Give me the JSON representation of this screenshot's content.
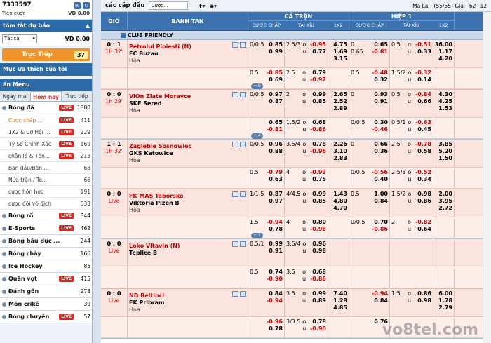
{
  "account": {
    "user": "7333597",
    "credit_label": "Tiền cược",
    "credit_value": "VD 0.00"
  },
  "summary": {
    "title": "tóm tắt dự báo",
    "select": "Tất cả",
    "balance": "VD 0.00"
  },
  "live_btn": {
    "label": "Trực Tiếp",
    "count": "37"
  },
  "favorites": {
    "label": "Mục ưa thích của tôi"
  },
  "menu": {
    "label": "ẩn Menu",
    "tabs": [
      "Ngày mai",
      "Hôm nay",
      "Trực tiếp"
    ]
  },
  "sports": [
    {
      "name": "Bóng đá",
      "live": true,
      "count": "1880"
    },
    {
      "name": "Bóng rổ",
      "live": true,
      "count": "344"
    },
    {
      "name": "E-Sports",
      "live": true,
      "count": "462"
    },
    {
      "name": "Bóng bầu dục ...",
      "live": false,
      "count": "244"
    },
    {
      "name": "Bóng chày",
      "live": false,
      "count": "166"
    },
    {
      "name": "Ice Hockey",
      "live": false,
      "count": "85"
    },
    {
      "name": "Quần vợt",
      "live": true,
      "count": "415"
    },
    {
      "name": "Đánh gôn",
      "live": false,
      "count": "278"
    },
    {
      "name": "Môn crikê",
      "live": false,
      "count": "39"
    },
    {
      "name": "Bóng chuyền",
      "live": true,
      "count": "57"
    }
  ],
  "football_subs": [
    {
      "name": "Cược chấp ...",
      "live": true,
      "count": "411"
    },
    {
      "name": "1X2 & Cơ Hội ...",
      "live": true,
      "count": "229"
    },
    {
      "name": "Tỷ Số Chính Xác",
      "live": true,
      "count": "169"
    },
    {
      "name": "chẵn lẻ & Tổn...",
      "live": true,
      "count": "213"
    },
    {
      "name": "Bàn đầu/Bàn ...",
      "live": false,
      "count": "68"
    },
    {
      "name": "Nửa trận / To...",
      "live": false,
      "count": "66"
    },
    {
      "name": "cược hỗn hợp",
      "live": false,
      "count": "191"
    },
    {
      "name": "cược đội vô địch",
      "live": false,
      "count": "533"
    }
  ],
  "topbar": {
    "title": "các cặp đấu",
    "search": "Cược...",
    "market": "Mã Lai",
    "count": "(55/55) Giải",
    "n1": "62",
    "n2": "12"
  },
  "header": {
    "time": "GIỜ",
    "team": "BANH TAN",
    "ft": "CẢ TRẬN",
    "ht": "HIỆP 1",
    "hc": "CƯỢC CHẤP",
    "ou": "TÀI XỈU",
    "x12": "1X2"
  },
  "league": "CLUB FRIENDLY",
  "matches": [
    {
      "score": "0 : 1",
      "time": "1H 32'",
      "home": "Petrolul Ploiesti (N)",
      "away": "FC Buzau",
      "draw": "Hòa",
      "rows": [
        {
          "hc": [
            "0/0.5",
            ""
          ],
          "hcv": [
            "0.85",
            "0.99"
          ],
          "ou": [
            "2.5/3",
            ""
          ],
          "ouu": [
            "o",
            "u"
          ],
          "ouv": [
            "-0.95",
            "0.77"
          ],
          "x12": [
            "4.75",
            "1.69",
            "3.15"
          ],
          "hc2": [
            "0",
            "0.65"
          ],
          "hc2v": [
            "0.65",
            "-0.81"
          ],
          "ou2": [
            "0.5",
            ""
          ],
          "ou2u": [
            "o",
            "u"
          ],
          "ou2v": [
            "-0.51",
            "0.33"
          ],
          "x122": [
            "36.00",
            "1.17",
            "4.20"
          ]
        },
        {
          "hc": [
            "0.5",
            ""
          ],
          "hcv": [
            "-0.85",
            "0.69"
          ],
          "ou": [
            "2.5",
            ""
          ],
          "ouu": [
            "o",
            "u"
          ],
          "ouv": [
            "0.79",
            "-0.97"
          ],
          "x12": [
            "",
            "",
            ""
          ],
          "hc2": [
            "0.5",
            ""
          ],
          "hc2v": [
            "-0.48",
            "0.32"
          ],
          "ou2": [
            "1.5/2",
            ""
          ],
          "ou2u": [
            "o",
            "u"
          ],
          "ou2v": [
            "-0.32",
            "0.14"
          ],
          "x122": [
            "",
            "",
            ""
          ],
          "plus": "+ 5"
        }
      ]
    },
    {
      "score": "0 : 0",
      "time": "1H 29'",
      "home": "ViOn Zlate Moravce",
      "away": "SKF Sered",
      "draw": "Hòa",
      "rows": [
        {
          "hc": [
            "0/0.5",
            ""
          ],
          "hcv": [
            "0.97",
            "0.87"
          ],
          "ou": [
            "2",
            ""
          ],
          "ouu": [
            "o",
            "u"
          ],
          "ouv": [
            "0.99",
            "0.85"
          ],
          "x12": [
            "2.65",
            "2.52",
            "2.89"
          ],
          "hc2": [
            "0",
            ""
          ],
          "hc2v": [
            "0.93",
            "0.91"
          ],
          "ou2": [
            "0.5",
            ""
          ],
          "ou2u": [
            "o",
            "u"
          ],
          "ou2v": [
            "-0.84",
            "0.66"
          ],
          "x122": [
            "4.30",
            "4.25",
            "1.53"
          ]
        },
        {
          "hc": [
            "",
            ""
          ],
          "hcv": [
            "0.65",
            "-0.81"
          ],
          "ou": [
            "1.5/2",
            ""
          ],
          "ouu": [
            "o",
            "u"
          ],
          "ouv": [
            "0.68",
            "-0.86"
          ],
          "x12": [
            "",
            "",
            ""
          ],
          "hc2": [
            "0/0.5",
            ""
          ],
          "hc2v": [
            "0.30",
            "-0.46"
          ],
          "ou2": [
            "0.5/1",
            ""
          ],
          "ou2u": [
            "o",
            "u"
          ],
          "ou2v": [
            "-0.63",
            "0.45"
          ],
          "x122": [
            "",
            "",
            ""
          ],
          "plus": "+ 4"
        }
      ]
    },
    {
      "score": "1 : 1",
      "time": "1H 32'",
      "home": "Zaglebie Sosnowiec",
      "away": "GKS Katowice",
      "draw": "Hòa",
      "rows": [
        {
          "hc": [
            "0/0.5",
            ""
          ],
          "hcv": [
            "0.96",
            "0.88"
          ],
          "ou": [
            "3.5/4",
            ""
          ],
          "ouu": [
            "o",
            "u"
          ],
          "ouv": [
            "0.78",
            "-0.96"
          ],
          "x12": [
            "2.26",
            "3.10",
            "2.83"
          ],
          "hc2": [
            "0",
            ""
          ],
          "hc2v": [
            "0.66",
            "0.36"
          ],
          "ou2": [
            "2.5",
            ""
          ],
          "ou2u": [
            "o",
            "u"
          ],
          "ou2v": [
            "-0.78",
            "0.58"
          ],
          "x122": [
            "3.85",
            "5.20",
            "1.50"
          ]
        },
        {
          "hc": [
            "0.5",
            ""
          ],
          "hcv": [
            "-0.79",
            "0.63"
          ],
          "ou": [
            "4",
            ""
          ],
          "ouu": [
            "o",
            "u"
          ],
          "ouv": [
            "-0.93",
            "0.75"
          ],
          "x12": [
            "",
            "",
            ""
          ],
          "hc2": [
            "0/0.5",
            ""
          ],
          "hc2v": [
            "-0.56",
            "0.40"
          ],
          "ou2": [
            "2.5/3",
            ""
          ],
          "ou2u": [
            "o",
            "u"
          ],
          "ou2v": [
            "-0.52",
            "0.34"
          ],
          "x122": [
            "",
            "",
            ""
          ]
        }
      ]
    },
    {
      "score": "0 : 0",
      "time": "Live",
      "home": "FK MAS Taborsko",
      "away": "Viktoria Plzen B",
      "draw": "Hòa",
      "rows": [
        {
          "hc": [
            "1/1.5",
            ""
          ],
          "hcv": [
            "0.87",
            "0.97"
          ],
          "ou": [
            "4/4.5",
            ""
          ],
          "ouu": [
            "o",
            "u"
          ],
          "ouv": [
            "0.99",
            "0.85"
          ],
          "x12": [
            "1.43",
            "4.80",
            "4.70"
          ],
          "hc2": [
            "0.5",
            ""
          ],
          "hc2v": [
            "1.00",
            "0.84"
          ],
          "ou2": [
            "1.5/2",
            ""
          ],
          "ou2u": [
            "o",
            "u"
          ],
          "ou2v": [
            "0.98",
            "0.86"
          ],
          "x122": [
            "2.00",
            "3.95",
            "2.72"
          ]
        },
        {
          "hc": [
            "1.5",
            ""
          ],
          "hcv": [
            "-0.94",
            "0.78"
          ],
          "ou": [
            "4",
            ""
          ],
          "ouu": [
            "o",
            "u"
          ],
          "ouv": [
            "0.80",
            "-0.98"
          ],
          "x12": [
            "",
            "",
            ""
          ],
          "hc2": [
            "0/0.5",
            ""
          ],
          "hc2v": [
            "0.70",
            "-0.86"
          ],
          "ou2": [
            "2",
            ""
          ],
          "ou2u": [
            "o",
            "u"
          ],
          "ou2v": [
            "-0.82",
            "0.64"
          ],
          "x122": [
            "",
            "",
            ""
          ],
          "plus": "+ 1"
        }
      ]
    },
    {
      "score": "0 : 0",
      "time": "Live",
      "home": "Loko Vltavin (N)",
      "away": "Teplice B",
      "draw": "",
      "rows": [
        {
          "hc": [
            "0.5/1",
            ""
          ],
          "hcv": [
            "0.99",
            "0.91"
          ],
          "ou": [
            "3.5/4",
            ""
          ],
          "ouu": [
            "o",
            "u"
          ],
          "ouv": [
            "0.96",
            "0.98"
          ],
          "x12": [
            "",
            "",
            ""
          ],
          "hc2": [
            "",
            ""
          ],
          "hc2v": [
            "",
            ""
          ],
          "ou2": [
            "",
            ""
          ],
          "ou2u": [
            "",
            ""
          ],
          "ou2v": [
            "",
            ""
          ],
          "x122": [
            "",
            "",
            ""
          ]
        },
        {
          "hc": [
            "0.5",
            ""
          ],
          "hcv": [
            "0.74",
            "-0.90"
          ],
          "ou": [
            "3.5",
            ""
          ],
          "ouu": [
            "o",
            "u"
          ],
          "ouv": [
            "0.68",
            "-0.86"
          ],
          "x12": [
            "",
            "",
            ""
          ],
          "hc2": [
            "",
            ""
          ],
          "hc2v": [
            "",
            ""
          ],
          "ou2": [
            "",
            ""
          ],
          "ou2u": [
            "",
            ""
          ],
          "ou2v": [
            "",
            ""
          ],
          "x122": [
            "",
            "",
            ""
          ]
        }
      ]
    },
    {
      "score": "0 : 0",
      "time": "Live",
      "home": "ND Beltinci",
      "away": "FK Pribram",
      "draw": "Hòa",
      "rows": [
        {
          "hc": [
            "",
            ""
          ],
          "hcv": [
            "0.84",
            "-0.94"
          ],
          "ou": [
            "3.5",
            ""
          ],
          "ouu": [
            "o",
            "u"
          ],
          "ouv": [
            "0.99",
            "0.89"
          ],
          "x12": [
            "7.40",
            "1.28",
            "4.85"
          ],
          "hc2": [
            "",
            ""
          ],
          "hc2v": [
            "-0.94",
            "0.84"
          ],
          "ou2": [
            "1.5",
            ""
          ],
          "ou2u": [
            "o",
            "u"
          ],
          "ou2v": [
            "0.86",
            "0.98"
          ],
          "x122": [
            "6.00",
            "1.78",
            "2.79"
          ]
        },
        {
          "hc": [
            "",
            ""
          ],
          "hcv": [
            "-0.96",
            "0.78"
          ],
          "ou": [
            "3/3.5",
            ""
          ],
          "ouu": [
            "o",
            "u"
          ],
          "ouv": [
            "0.78",
            "-0.90"
          ],
          "x12": [
            "",
            "",
            ""
          ],
          "hc2": [
            "",
            ""
          ],
          "hc2v": [
            "0.76",
            ""
          ],
          "ou2": [
            "",
            ""
          ],
          "ou2u": [
            "",
            ""
          ],
          "ou2v": [
            "",
            ""
          ],
          "x122": [
            "",
            "",
            ""
          ]
        }
      ]
    }
  ],
  "watermark": "vo8tel.com"
}
